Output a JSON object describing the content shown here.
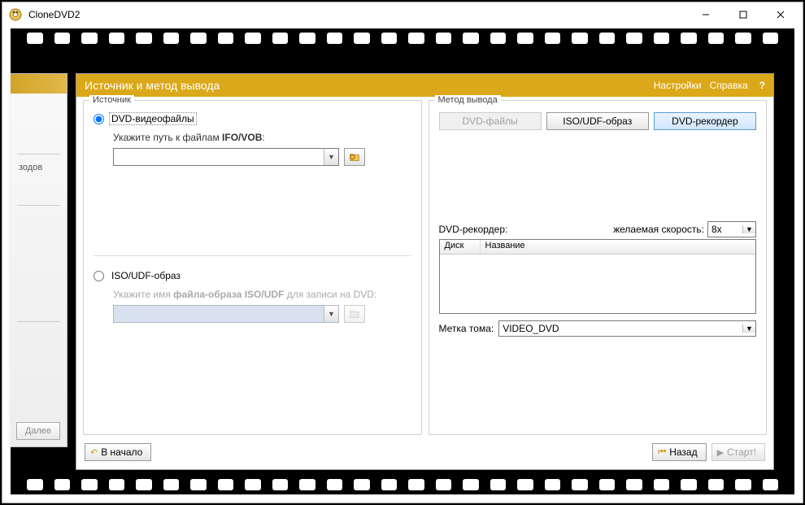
{
  "window": {
    "title": "CloneDVD2"
  },
  "header": {
    "title": "Источник и метод вывода",
    "settings": "Настройки",
    "help": "Справка",
    "q": "?"
  },
  "back_card": {
    "line1": "зодов",
    "button": "Далее"
  },
  "source": {
    "legend": "Источник",
    "radio_dvd_files": "DVD-видеофайлы",
    "hint_dvd_files_prefix": "Укажите путь к файлам ",
    "hint_dvd_files_bold": "IFO/VOB",
    "hint_dvd_files_suffix": ":",
    "radio_iso": "ISO/UDF-образ",
    "hint_iso_prefix": "Укажите имя ",
    "hint_iso_bold": "файла-образа ISO/UDF",
    "hint_iso_suffix": " для записи на DVD:"
  },
  "output": {
    "legend": "Метод вывода",
    "tab_dvd_files": "DVD-файлы",
    "tab_iso": "ISO/UDF-образ",
    "tab_recorder": "DVD-рекордер",
    "recorder_label": "DVD-рекордер:",
    "speed_label": "желаемая скорость:",
    "speed_value": "8x",
    "col_disc": "Диск",
    "col_name": "Название",
    "volume_label": "Метка тома:",
    "volume_value": "VIDEO_DVD"
  },
  "footer": {
    "begin": "В начало",
    "back": "Назад",
    "start": "Старт!"
  }
}
